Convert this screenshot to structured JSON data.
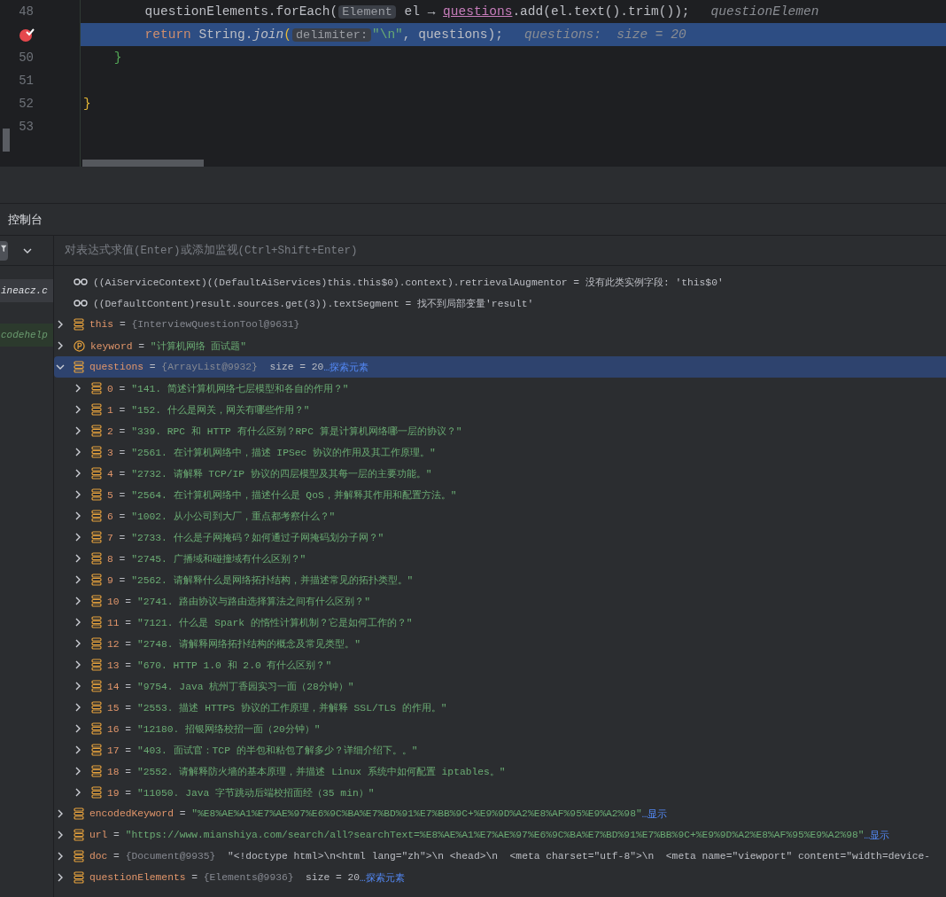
{
  "editor": {
    "lines": [
      {
        "number": "48",
        "segments": [
          {
            "kind": "plain",
            "text": "        questionElements.forEach("
          },
          {
            "kind": "hint",
            "text": "Element"
          },
          {
            "kind": "plain",
            "text": " el → "
          },
          {
            "kind": "field",
            "text": "questions"
          },
          {
            "kind": "plain",
            "text": ".add(el.text().trim());"
          },
          {
            "kind": "inline",
            "text": "questionElemen"
          }
        ]
      },
      {
        "breakpoint": true,
        "current": true,
        "segments": [
          {
            "kind": "keyword",
            "text": "        return"
          },
          {
            "kind": "plain",
            "text": " String."
          },
          {
            "kind": "method",
            "text": "join"
          },
          {
            "kind": "paren",
            "text": "("
          },
          {
            "kind": "hint",
            "text": "delimiter:"
          },
          {
            "kind": "string",
            "text": "\"\\n\""
          },
          {
            "kind": "plain",
            "text": ", questions);"
          },
          {
            "kind": "inline",
            "text": "questions:  size = 20"
          }
        ]
      },
      {
        "number": "50",
        "segments": [
          {
            "kind": "brace-green",
            "text": "    }"
          }
        ]
      },
      {
        "number": "51"
      },
      {
        "number": "52",
        "segments": [
          {
            "kind": "brace-yellow",
            "text": "}"
          }
        ]
      },
      {
        "number": "53"
      }
    ]
  },
  "console": {
    "title": "控制台",
    "frames": [
      {
        "label": "ineacz.c",
        "selected": true
      },
      {
        "label": "codehelp",
        "selected": false
      }
    ],
    "eval_placeholder": "对表达式求值(Enter)或添加监视(Ctrl+Shift+Enter)",
    "watches": [
      {
        "text": "((AiServiceContext)((DefaultAiServices)this.this$0).context).retrievalAugmentor = 没有此类实例字段: 'this$0'"
      },
      {
        "text": "((DefaultContent)result.sources.get(3)).textSegment = 找不到局部变量'result'"
      }
    ],
    "variables": [
      {
        "kind": "field",
        "name": "this",
        "eq": "=",
        "expanded": false,
        "selected": false,
        "ref": "{InterviewQuestionTool@9631}"
      },
      {
        "kind": "param",
        "name": "keyword",
        "eq": "=",
        "expanded": false,
        "selected": false,
        "value": "\"计算机网络 面试题\""
      },
      {
        "kind": "field",
        "name": "questions",
        "eq": "=",
        "expanded": true,
        "selected": true,
        "ref": "{ArrayList@9932}",
        "extra": "size = 20",
        "link": "…探索元素",
        "children": [
          {
            "kind": "field",
            "name": "0",
            "eq": "=",
            "value": "\"141. 简述计算机网络七层模型和各自的作用？\""
          },
          {
            "kind": "field",
            "name": "1",
            "eq": "=",
            "value": "\"152. 什么是网关，网关有哪些作用？\""
          },
          {
            "kind": "field",
            "name": "2",
            "eq": "=",
            "value": "\"339. RPC 和 HTTP 有什么区别？RPC 算是计算机网络哪一层的协议？\""
          },
          {
            "kind": "field",
            "name": "3",
            "eq": "=",
            "value": "\"2561. 在计算机网络中，描述 IPSec 协议的作用及其工作原理。\""
          },
          {
            "kind": "field",
            "name": "4",
            "eq": "=",
            "value": "\"2732. 请解释 TCP/IP 协议的四层模型及其每一层的主要功能。\""
          },
          {
            "kind": "field",
            "name": "5",
            "eq": "=",
            "value": "\"2564. 在计算机网络中，描述什么是 QoS，并解释其作用和配置方法。\""
          },
          {
            "kind": "field",
            "name": "6",
            "eq": "=",
            "value": "\"1002. 从小公司到大厂，重点都考察什么？\""
          },
          {
            "kind": "field",
            "name": "7",
            "eq": "=",
            "value": "\"2733. 什么是子网掩码？如何通过子网掩码划分子网？\""
          },
          {
            "kind": "field",
            "name": "8",
            "eq": "=",
            "value": "\"2745. 广播域和碰撞域有什么区别？\""
          },
          {
            "kind": "field",
            "name": "9",
            "eq": "=",
            "value": "\"2562. 请解释什么是网络拓扑结构，并描述常见的拓扑类型。\""
          },
          {
            "kind": "field",
            "name": "10",
            "eq": "=",
            "value": "\"2741. 路由协议与路由选择算法之间有什么区别？\""
          },
          {
            "kind": "field",
            "name": "11",
            "eq": "=",
            "value": "\"7121. 什么是 Spark 的惰性计算机制？它是如何工作的？\""
          },
          {
            "kind": "field",
            "name": "12",
            "eq": "=",
            "value": "\"2748. 请解释网络拓扑结构的概念及常见类型。\""
          },
          {
            "kind": "field",
            "name": "13",
            "eq": "=",
            "value": "\"670. HTTP 1.0 和 2.0 有什么区别？\""
          },
          {
            "kind": "field",
            "name": "14",
            "eq": "=",
            "value": "\"9754. Java 杭州丁香园实习一面（28分钟）\""
          },
          {
            "kind": "field",
            "name": "15",
            "eq": "=",
            "value": "\"2553. 描述 HTTPS 协议的工作原理，并解释 SSL/TLS 的作用。\""
          },
          {
            "kind": "field",
            "name": "16",
            "eq": "=",
            "value": "\"12180. 招银网络校招一面（20分钟）\""
          },
          {
            "kind": "field",
            "name": "17",
            "eq": "=",
            "value": "\"403. 面试官：TCP 的半包和粘包了解多少？详细介绍下。。\""
          },
          {
            "kind": "field",
            "name": "18",
            "eq": "=",
            "value": "\"2552. 请解释防火墙的基本原理，并描述 Linux 系统中如何配置 iptables。\""
          },
          {
            "kind": "field",
            "name": "19",
            "eq": "=",
            "value": "\"11050. Java 字节跳动后端校招面经（35 min）\""
          }
        ]
      },
      {
        "kind": "field",
        "name": "encodedKeyword",
        "eq": "=",
        "expanded": false,
        "selected": false,
        "value": "\"%E8%AE%A1%E7%AE%97%E6%9C%BA%E7%BD%91%E7%BB%9C+%E9%9D%A2%E8%AF%95%E9%A2%98\"",
        "link": "…显示"
      },
      {
        "kind": "field",
        "name": "url",
        "eq": "=",
        "expanded": false,
        "selected": false,
        "value": "\"https://www.mianshiya.com/search/all?searchText=%E8%AE%A1%E7%AE%97%E6%9C%BA%E7%BD%91%E7%BB%9C+%E9%9D%A2%E8%AF%95%E9%A2%98\"",
        "link": "…显示"
      },
      {
        "kind": "field",
        "name": "doc",
        "eq": "=",
        "expanded": false,
        "selected": false,
        "ref": "{Document@9935}",
        "text": "\"<!doctype html>\\n<html lang=\"zh\">\\n <head>\\n  <meta charset=\"utf-8\">\\n  <meta name=\"viewport\" content=\"width=device-"
      },
      {
        "kind": "field",
        "name": "questionElements",
        "eq": "=",
        "expanded": false,
        "selected": false,
        "ref": "{Elements@9936}",
        "extra": "size = 20",
        "link": "…探索元素"
      }
    ]
  }
}
